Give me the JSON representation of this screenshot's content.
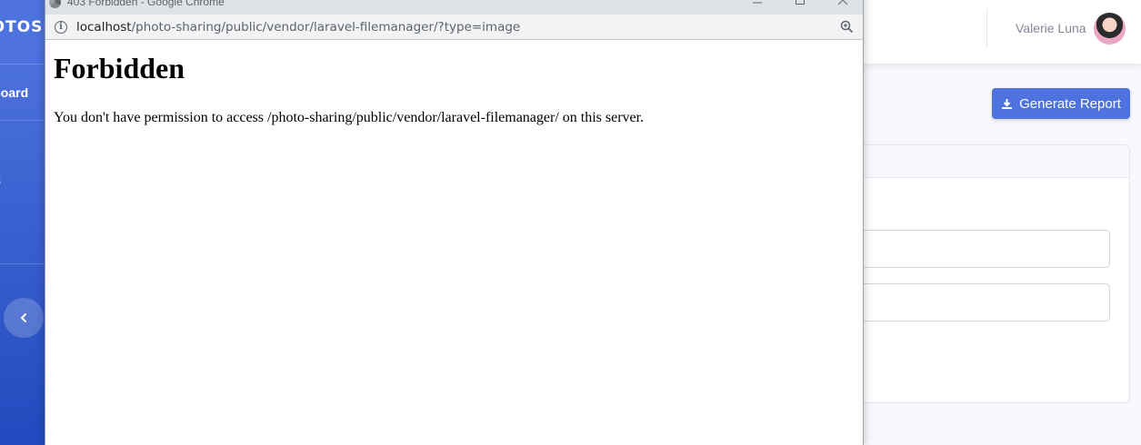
{
  "app": {
    "brand": "PHOTOSHARE",
    "nav_dashboard": "Dashboard",
    "nav_partial": "s",
    "user_name": "Valerie Luna",
    "report_button": "Generate Report",
    "accent": "#4e73df"
  },
  "popup": {
    "window_title": "403 Forbidden - Google Chrome",
    "url_host": "localhost",
    "url_path": "/photo-sharing/public/vendor/laravel-filemanager/?type=image",
    "heading": "Forbidden",
    "message": "You don't have permission to access /photo-sharing/public/vendor/laravel-filemanager/ on this server."
  },
  "icons": [
    "chrome-icon",
    "info-icon",
    "zoom-icon",
    "minimize-icon",
    "maximize-icon",
    "close-icon",
    "chevron-left-icon",
    "download-icon",
    "avatar"
  ]
}
